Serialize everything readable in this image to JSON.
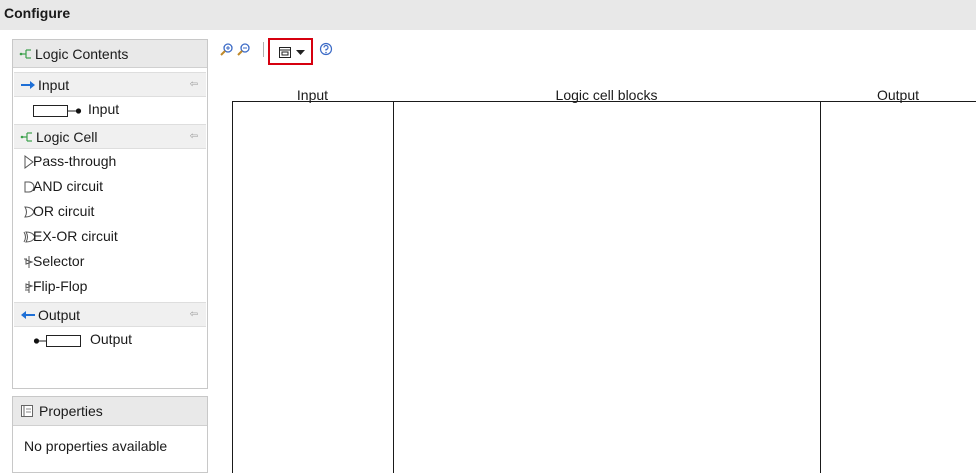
{
  "window": {
    "title": "Configure"
  },
  "palette": {
    "header": "Logic Contents",
    "sections": [
      {
        "label": "Input",
        "items": [
          {
            "label": "Input"
          }
        ]
      },
      {
        "label": "Logic Cell",
        "items": [
          {
            "label": "Pass-through"
          },
          {
            "label": "AND circuit"
          },
          {
            "label": "OR circuit"
          },
          {
            "label": "EX-OR circuit"
          },
          {
            "label": "Selector"
          },
          {
            "label": "Flip-Flop"
          }
        ]
      },
      {
        "label": "Output",
        "items": [
          {
            "label": "Output"
          }
        ]
      }
    ]
  },
  "properties": {
    "header": "Properties",
    "empty_text": "No properties available"
  },
  "table": {
    "columns": [
      "Input",
      "Logic cell blocks",
      "Output"
    ]
  },
  "colors": {
    "highlight_border": "#d6000f",
    "accent_arrow": "#1e6fd6",
    "logic_icon": "#3aa04a"
  }
}
